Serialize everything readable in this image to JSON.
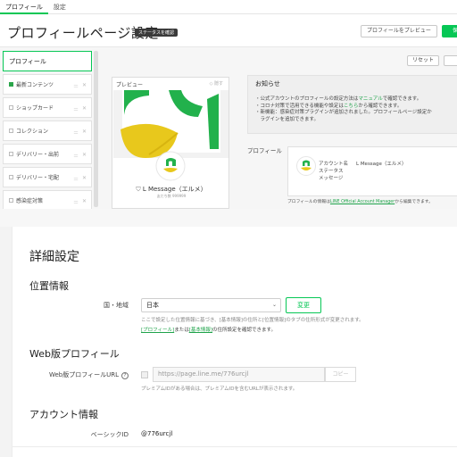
{
  "tabs": [
    {
      "label": "プロフィール",
      "active": true
    },
    {
      "label": "設定",
      "active": false
    }
  ],
  "header": {
    "title": "プロフィールページ設定",
    "status_badge": "ステータスを確認",
    "preview_button": "プロフィールをプレビュー",
    "save_button": "保"
  },
  "sidebar": {
    "items": [
      {
        "label": "プロフィール"
      },
      {
        "label": "最新コンテンツ",
        "checked": true
      },
      {
        "label": "ショップカード",
        "checked": false
      },
      {
        "label": "コレクション",
        "checked": false
      },
      {
        "label": "デリバリー・出前",
        "checked": false
      },
      {
        "label": "デリバリー・宅配",
        "checked": false
      },
      {
        "label": "感染症対策",
        "checked": false
      }
    ]
  },
  "preview": {
    "label": "プレビュー",
    "close": "◇ 隠す",
    "account_name": "L Message（エルメ）",
    "account_sub": "友だち数 999999"
  },
  "right_panel": {
    "reset_button": "リセット",
    "notice": {
      "title": "お知らせ",
      "l1_pre": "・公式アカウントのプロフィールの設定方法は",
      "l1_link": "マニュアル",
      "l1_post": "で確認できます。",
      "l2_pre": "・コロナ対策で活用できる機能や設定は",
      "l2_link": "こちら",
      "l2_post": "から確認できます。",
      "l3": "・新機能：感染症対策プラグインが追加されました。プロフィールページ設定か",
      "l4": "　ラグインを追加できます。"
    },
    "profile_label": "プロフィール",
    "profile_fields": {
      "account_name_key": "アカウント名",
      "account_name_val": "L Message（エルメ）",
      "status_key": "ステータス",
      "message_key": "メッセージ"
    },
    "profile_note_pre": "プロフィールの情報は",
    "profile_note_link": "LINE Official Account Manager",
    "profile_note_post": "から編集できます。"
  },
  "detail": {
    "title": "詳細設定",
    "location": {
      "section_title": "位置情報",
      "country_label": "国・地域",
      "country_value": "日本",
      "change_button": "変更",
      "note1": "ここで設定した位置情報に基づき、[基本情報]の住所と[位置情報]のタブの住所形式が変更されます。",
      "note2_link1": "[プロフィール]",
      "note2_mid": "または",
      "note2_link2": "[基本情報]",
      "note2_post": "の住所設定を確認できます。"
    },
    "web_profile": {
      "section_title": "Web版プロフィール",
      "url_label": "Web版プロフィールURL",
      "help": "?",
      "url_value": "https://page.line.me/776urcjl",
      "copy_button": "コピー",
      "note": "プレミアムIDがある場合は、プレミアムIDを含むURLが表示されます。"
    },
    "account_info": {
      "section_title": "アカウント情報",
      "basic_id_label": "ベーシックID",
      "basic_id_value": "@776urcjl"
    }
  },
  "colors": {
    "accent": "#06c755",
    "link": "#1fa34a",
    "badge": "#3a3a3a"
  }
}
